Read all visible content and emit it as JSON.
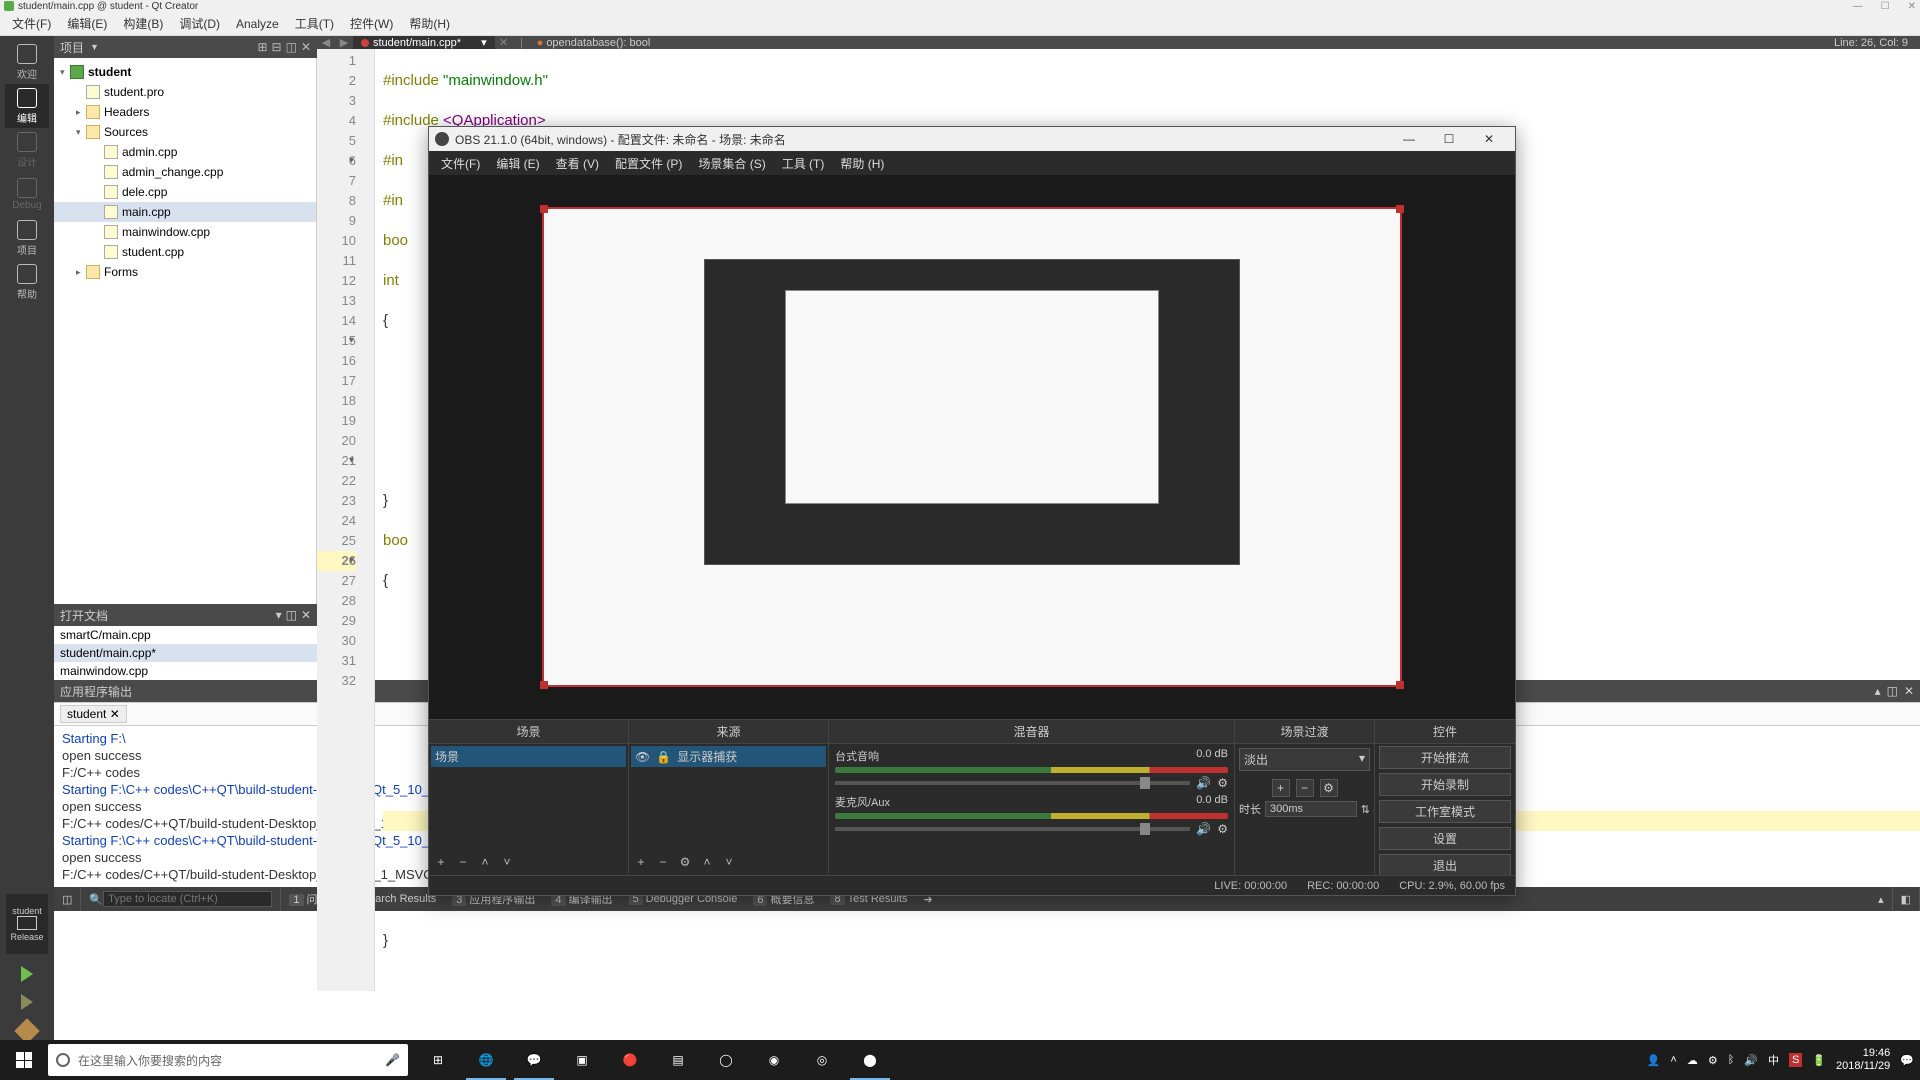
{
  "qt": {
    "title": "student/main.cpp @ student - Qt Creator",
    "menu": [
      "文件(F)",
      "编辑(E)",
      "构建(B)",
      "调试(D)",
      "Analyze",
      "工具(T)",
      "控件(W)",
      "帮助(H)"
    ],
    "sidebar": {
      "items": [
        {
          "label": "欢迎"
        },
        {
          "label": "编辑"
        },
        {
          "label": "设计"
        },
        {
          "label": "Debug"
        },
        {
          "label": "项目"
        },
        {
          "label": "帮助"
        }
      ],
      "run_target": "student",
      "run_config": "Release"
    },
    "project_header": "项目",
    "tree": {
      "root": "student",
      "pro": "student.pro",
      "headers": "Headers",
      "sources": "Sources",
      "src_items": [
        "admin.cpp",
        "admin_change.cpp",
        "dele.cpp",
        "main.cpp",
        "mainwindow.cpp",
        "student.cpp"
      ],
      "forms": "Forms"
    },
    "openfiles_hdr": "打开文档",
    "openfiles": [
      "smartC/main.cpp",
      "student/main.cpp*",
      "mainwindow.cpp"
    ],
    "editor": {
      "tab_file": "student/main.cpp*",
      "breadcrumb": "opendatabase(): bool",
      "location": "Line: 26, Col: 9",
      "line_numbers": [
        "1",
        "2",
        "3",
        "4",
        "5",
        "6",
        "7",
        "8",
        "9",
        "10",
        "11",
        "12",
        "13",
        "14",
        "15",
        "16",
        "17",
        "18",
        "19",
        "20",
        "21",
        "22",
        "23",
        "24",
        "25",
        "26",
        "27",
        "28",
        "29",
        "30",
        "31",
        "32"
      ],
      "lines": {
        "l1a": "#include ",
        "l1b": "\"mainwindow.h\"",
        "l2a": "#include ",
        "l2b": "<QApplication>",
        "l3": "#in",
        "l4": "#in",
        "l5": "boo",
        "l6": "int",
        "l7": "{",
        "l14": "}",
        "l15": "boo",
        "l16": "{",
        "l31": "}"
      }
    },
    "output_hdr": "应用程序输出",
    "output_chip": "student",
    "output": [
      "Starting F:\\",
      "open success",
      "F:/C++ codes",
      "",
      "Starting F:\\C++ codes\\C++QT\\build-student-Desktop_Qt_5_10_1_MSVC2017_64bit-Release\\release\\student.exe...",
      "open success",
      "F:/C++ codes/C++QT/build-student-Desktop_Qt_5_10_1_MSVC2017_64bit-Release/release/student.exe exited with code 0",
      "",
      "Starting F:\\C++ codes\\C++QT\\build-student-Desktop_Qt_5_10_1_MSVC2017_64bit-Release\\release\\student.exe...",
      "open success",
      "F:/C++ codes/C++QT/build-student-Desktop_Qt_5_10_1_MSVC2017_64bit-Release/release/student.exe exited with code 0"
    ],
    "status": {
      "search_ph": "Type to locate (Ctrl+K)",
      "tabs": [
        "问题",
        "Search Results",
        "应用程序输出",
        "编译输出",
        "Debugger Console",
        "概要信息",
        "Test Results"
      ]
    }
  },
  "obs": {
    "title": "OBS 21.1.0 (64bit, windows) - 配置文件: 未命名 - 场景: 未命名",
    "menu": [
      "文件(F)",
      "编辑 (E)",
      "查看 (V)",
      "配置文件 (P)",
      "场景集合 (S)",
      "工具 (T)",
      "帮助 (H)"
    ],
    "panels": {
      "scenes": "场景",
      "sources": "来源",
      "mixer": "混音器",
      "transitions": "场景过渡",
      "controls": "控件"
    },
    "scene_item": "场景",
    "source_item": "显示器捕获",
    "mixer": {
      "desk": {
        "name": "台式音响",
        "db": "0.0 dB"
      },
      "mic": {
        "name": "麦克风/Aux",
        "db": "0.0 dB"
      }
    },
    "transition": {
      "sel": "淡出",
      "dur_label": "时长",
      "dur_val": "300ms"
    },
    "controls": [
      "开始推流",
      "开始录制",
      "工作室模式",
      "设置",
      "退出"
    ],
    "status": {
      "live": "LIVE: 00:00:00",
      "rec": "REC: 00:00:00",
      "cpu": "CPU: 2.9%, 60.00 fps"
    }
  },
  "win": {
    "search_ph": "在这里输入你要搜索的内容",
    "time": "19:46",
    "date": "2018/11/29"
  }
}
